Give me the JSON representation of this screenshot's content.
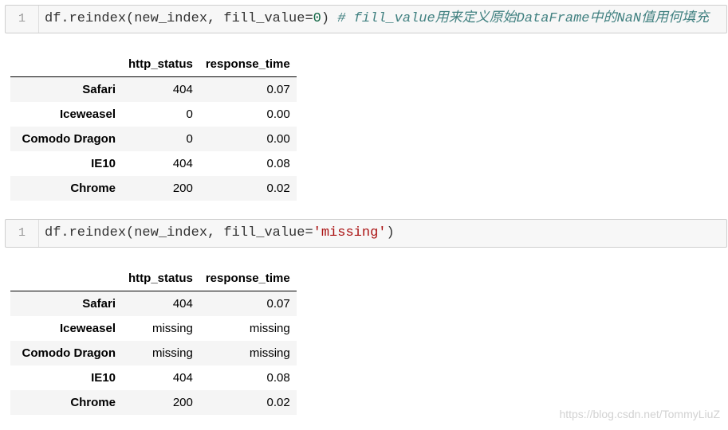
{
  "cells": [
    {
      "line_number": "1",
      "code_text": "df.reindex(new_index, fill_value=",
      "code_literal": "0",
      "code_close": ")",
      "comment": " # fill_value用来定义原始DataFrame中的NaN值用何填充"
    },
    {
      "line_number": "1",
      "code_text": "df.reindex(new_index, fill_value=",
      "code_literal": "'missing'",
      "code_close": ")",
      "comment": ""
    }
  ],
  "tables": [
    {
      "columns": [
        "",
        "http_status",
        "response_time"
      ],
      "rows": [
        {
          "index": "Safari",
          "http_status": "404",
          "response_time": "0.07"
        },
        {
          "index": "Iceweasel",
          "http_status": "0",
          "response_time": "0.00"
        },
        {
          "index": "Comodo Dragon",
          "http_status": "0",
          "response_time": "0.00"
        },
        {
          "index": "IE10",
          "http_status": "404",
          "response_time": "0.08"
        },
        {
          "index": "Chrome",
          "http_status": "200",
          "response_time": "0.02"
        }
      ]
    },
    {
      "columns": [
        "",
        "http_status",
        "response_time"
      ],
      "rows": [
        {
          "index": "Safari",
          "http_status": "404",
          "response_time": "0.07"
        },
        {
          "index": "Iceweasel",
          "http_status": "missing",
          "response_time": "missing"
        },
        {
          "index": "Comodo Dragon",
          "http_status": "missing",
          "response_time": "missing"
        },
        {
          "index": "IE10",
          "http_status": "404",
          "response_time": "0.08"
        },
        {
          "index": "Chrome",
          "http_status": "200",
          "response_time": "0.02"
        }
      ]
    }
  ],
  "watermark": "https://blog.csdn.net/TommyLiuZ"
}
